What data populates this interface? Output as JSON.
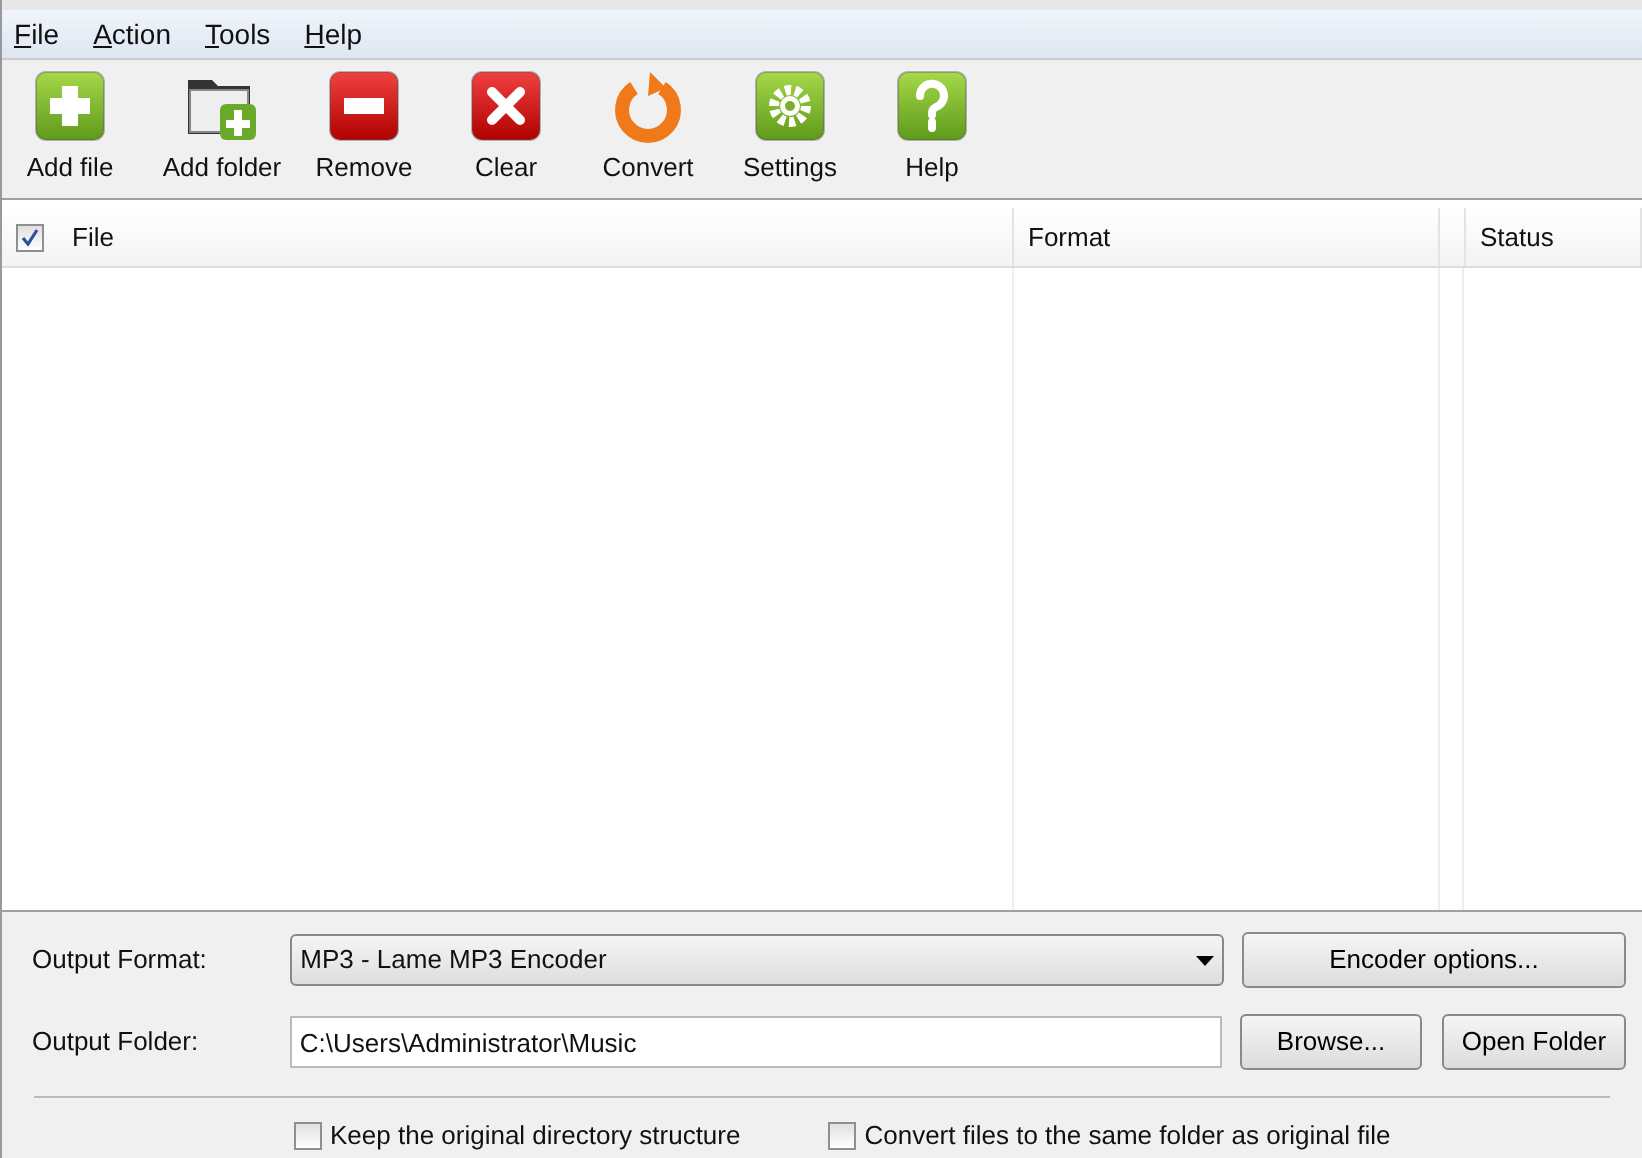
{
  "menu": [
    {
      "label": "File",
      "first_letter_underlined": true
    },
    {
      "label": "Action",
      "first_letter_underlined": true
    },
    {
      "label": "Tools",
      "first_letter_underlined": true
    },
    {
      "label": "Help",
      "first_letter_underlined": true
    }
  ],
  "toolbar": [
    {
      "label": "Add file",
      "kind": "add"
    },
    {
      "label": "Add folder",
      "kind": "folder"
    },
    {
      "label": "Remove",
      "kind": "remove"
    },
    {
      "label": "Clear",
      "kind": "clear"
    },
    {
      "label": "Convert",
      "kind": "convert"
    },
    {
      "label": "Settings",
      "kind": "settings"
    },
    {
      "label": "Help",
      "kind": "help"
    }
  ],
  "table": {
    "select_all_checked": true,
    "columns": [
      "File",
      "Format",
      "Status"
    ]
  },
  "output_format": {
    "label": "Output Format:",
    "value": "MP3 - Lame MP3 Encoder",
    "button": "Encoder options..."
  },
  "output_folder": {
    "label": "Output Folder:",
    "value": "C:\\Users\\Administrator\\Music",
    "buttons": [
      "Browse...",
      "Open Folder"
    ]
  },
  "options": [
    {
      "label": "Keep the original directory structure",
      "checked": false
    },
    {
      "label": "Convert files to the same folder as original file",
      "checked": false
    }
  ]
}
